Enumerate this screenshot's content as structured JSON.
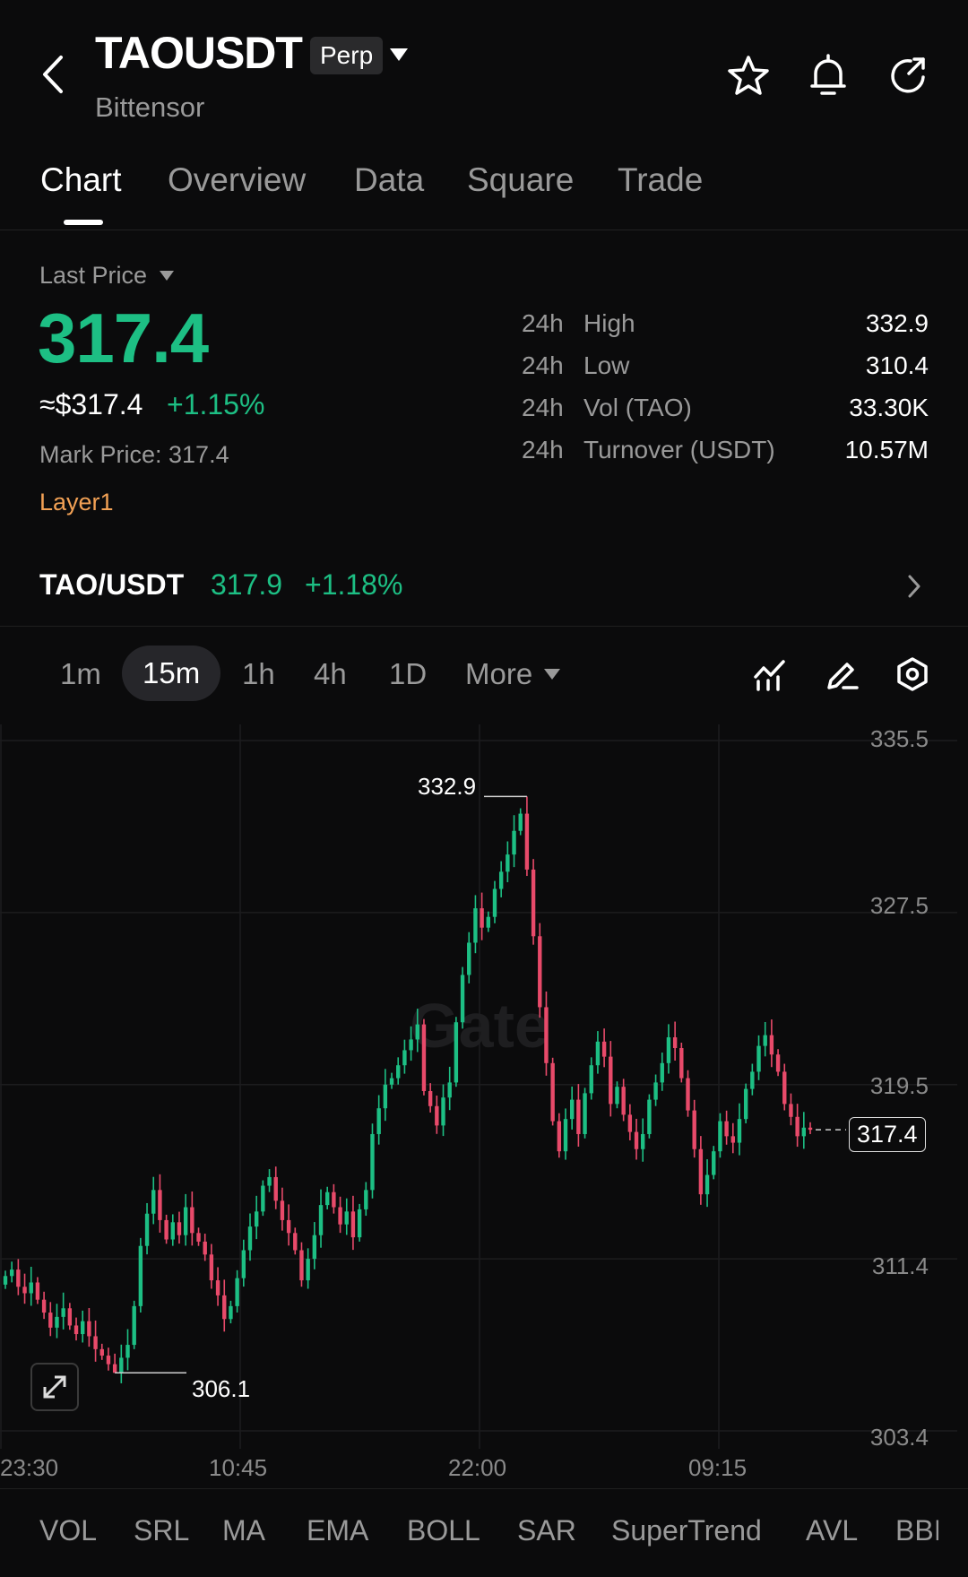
{
  "header": {
    "title": "TAOUSDT",
    "subtitle": "Bittensor",
    "badge": "Perp"
  },
  "tabs": [
    "Chart",
    "Overview",
    "Data",
    "Square",
    "Trade"
  ],
  "ticker": {
    "last_price_label": "Last Price",
    "last_price": "317.4",
    "usd_price": "≈$317.4",
    "change": "+1.15%",
    "mark_price": "Mark Price: 317.4",
    "tag": "Layer1",
    "stats": [
      {
        "k1": "24h",
        "k2": "High",
        "v": "332.9"
      },
      {
        "k1": "24h",
        "k2": "Low",
        "v": "310.4"
      },
      {
        "k1": "24h",
        "k2": "Vol (TAO)",
        "v": "33.30K"
      },
      {
        "k1": "24h",
        "k2": "Turnover (USDT)",
        "v": "10.57M"
      }
    ],
    "up_color": "#1dbf84",
    "down_color": "#e84a6a"
  },
  "spot": {
    "pair": "TAO/USDT",
    "price": "317.9",
    "change": "+1.18%"
  },
  "timeframes": [
    "1m",
    "15m",
    "1h",
    "4h",
    "1D",
    "More"
  ],
  "active_timeframe": "15m",
  "chart": {
    "y_labels": [
      "335.5",
      "327.5",
      "319.5",
      "311.4",
      "303.4"
    ],
    "x_labels": [
      "23:30",
      "10:45",
      "22:00",
      "09:15"
    ],
    "high_label": "332.9",
    "low_label": "306.1",
    "last_label": "317.4",
    "watermark": "Gate"
  },
  "chart_data": {
    "type": "candlestick",
    "ylim": [
      303.4,
      335.5
    ],
    "y_ticks": [
      335.5,
      327.5,
      319.5,
      311.4,
      303.4
    ],
    "x_ticks": [
      "23:30",
      "10:45",
      "22:00",
      "09:15"
    ],
    "high": 332.9,
    "low": 306.1,
    "last": 317.4,
    "closes": [
      310.6,
      310.9,
      310.1,
      309.8,
      310.3,
      309.5,
      308.9,
      308.2,
      308.7,
      309.1,
      308.3,
      307.9,
      308.5,
      307.8,
      307.2,
      306.9,
      306.5,
      306.1,
      306.8,
      307.4,
      309.2,
      312.0,
      313.5,
      314.6,
      313.2,
      312.3,
      313.1,
      312.5,
      313.8,
      312.6,
      312.2,
      311.6,
      310.4,
      309.7,
      308.6,
      309.2,
      310.5,
      311.8,
      312.9,
      313.6,
      314.8,
      315.2,
      314.1,
      313.2,
      312.6,
      311.8,
      310.4,
      311.4,
      312.5,
      313.9,
      314.5,
      313.8,
      313.0,
      313.6,
      312.4,
      313.7,
      314.6,
      317.2,
      318.4,
      319.5,
      319.8,
      320.4,
      321.1,
      321.6,
      322.3,
      319.2,
      318.5,
      317.6,
      318.9,
      319.6,
      322.4,
      324.6,
      326.1,
      327.7,
      326.8,
      327.3,
      328.6,
      329.4,
      330.2,
      331.3,
      332.1,
      329.5,
      326.4,
      323.1,
      320.5,
      317.8,
      316.4,
      317.9,
      318.8,
      317.2,
      319.1,
      320.4,
      321.5,
      320.8,
      318.6,
      319.4,
      318.1,
      317.3,
      316.5,
      317.2,
      318.8,
      319.6,
      320.5,
      321.7,
      321.2,
      319.8,
      318.3,
      316.5,
      314.4,
      315.3,
      316.4,
      317.8,
      317.1,
      316.8,
      317.9,
      319.3,
      320.1,
      321.3,
      321.8,
      320.9,
      320.1,
      318.6,
      318.0,
      317.1,
      317.5,
      317.4
    ]
  }
}
